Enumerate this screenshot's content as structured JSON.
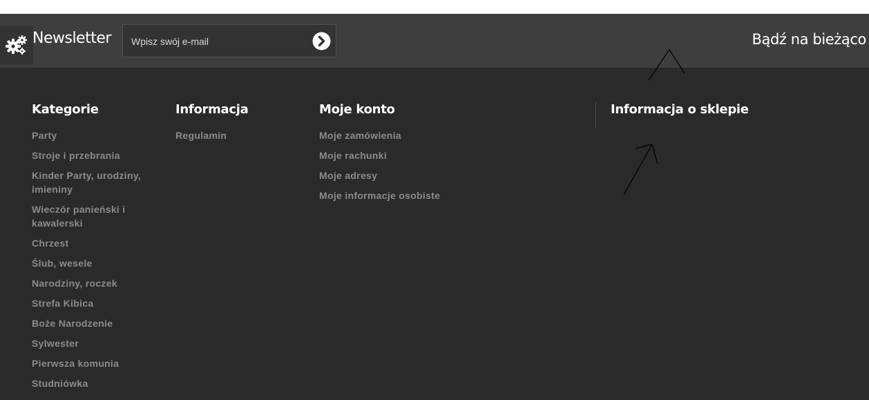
{
  "newsletter": {
    "title": "Newsletter",
    "email_placeholder": "Wpisz swój e-mail",
    "submit_icon": "chevron-right-circle-icon",
    "tagline": "Bądź na bieżąco"
  },
  "settings": {
    "icon": "gears-icon"
  },
  "footer": {
    "categories": {
      "heading": "Kategorie",
      "items": [
        "Party",
        "Stroje i przebrania",
        "Kinder Party, urodziny, imieniny",
        "Wieczór panieński i kawalerski",
        "Chrzest",
        "Ślub, wesele",
        "Narodziny, roczek",
        "Strefa Kibica",
        "Boże Narodzenie",
        "Sylwester",
        "Pierwsza komunia",
        "Studniówka"
      ]
    },
    "information": {
      "heading": "Informacja",
      "items": [
        "Regulamin"
      ]
    },
    "account": {
      "heading": "Moje konto",
      "items": [
        "Moje zamówienia",
        "Moje rachunki",
        "Moje adresy",
        "Moje informacje osobiste"
      ]
    },
    "shop_info": {
      "heading": "Informacja o sklepie"
    }
  },
  "colors": {
    "page_background": "#2a2a2b",
    "bar_background": "#3e3e3f",
    "heading_text": "#ffffff",
    "link_text": "#8c8c8c"
  }
}
